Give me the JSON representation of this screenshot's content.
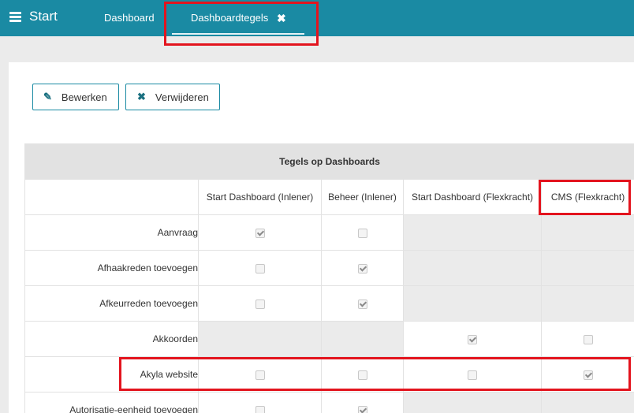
{
  "topbar": {
    "brand": "Start",
    "tabs": [
      {
        "label": "Dashboard"
      },
      {
        "label": "Dashboardtegels",
        "close_glyph": "✖"
      }
    ]
  },
  "toolbar": {
    "edit_label": "Bewerken",
    "edit_icon": "pencil-icon",
    "delete_label": "Verwijderen",
    "delete_icon": "x-icon"
  },
  "table": {
    "title": "Tegels op Dashboards",
    "columns": [
      "Start Dashboard (Inlener)",
      "Beheer (Inlener)",
      "Start Dashboard (Flexkracht)",
      "CMS (Flexkracht)"
    ],
    "rows": [
      {
        "label": "Aanvraag",
        "cells": [
          "checked",
          "unchecked",
          "na",
          "na"
        ]
      },
      {
        "label": "Afhaakreden toevoegen",
        "cells": [
          "unchecked",
          "checked",
          "na",
          "na"
        ]
      },
      {
        "label": "Afkeurreden toevoegen",
        "cells": [
          "unchecked",
          "checked",
          "na",
          "na"
        ]
      },
      {
        "label": "Akkoorden",
        "cells": [
          "na",
          "na",
          "checked",
          "unchecked"
        ]
      },
      {
        "label": "Akyla website",
        "cells": [
          "unchecked",
          "unchecked",
          "unchecked",
          "checked"
        ]
      },
      {
        "label": "Autorisatie-eenheid toevoegen",
        "cells": [
          "unchecked",
          "checked",
          "na",
          "na"
        ]
      }
    ]
  },
  "colors": {
    "topbar": "#1a8aa3",
    "highlight": "#e3141e",
    "na_cell": "#ebebeb"
  }
}
